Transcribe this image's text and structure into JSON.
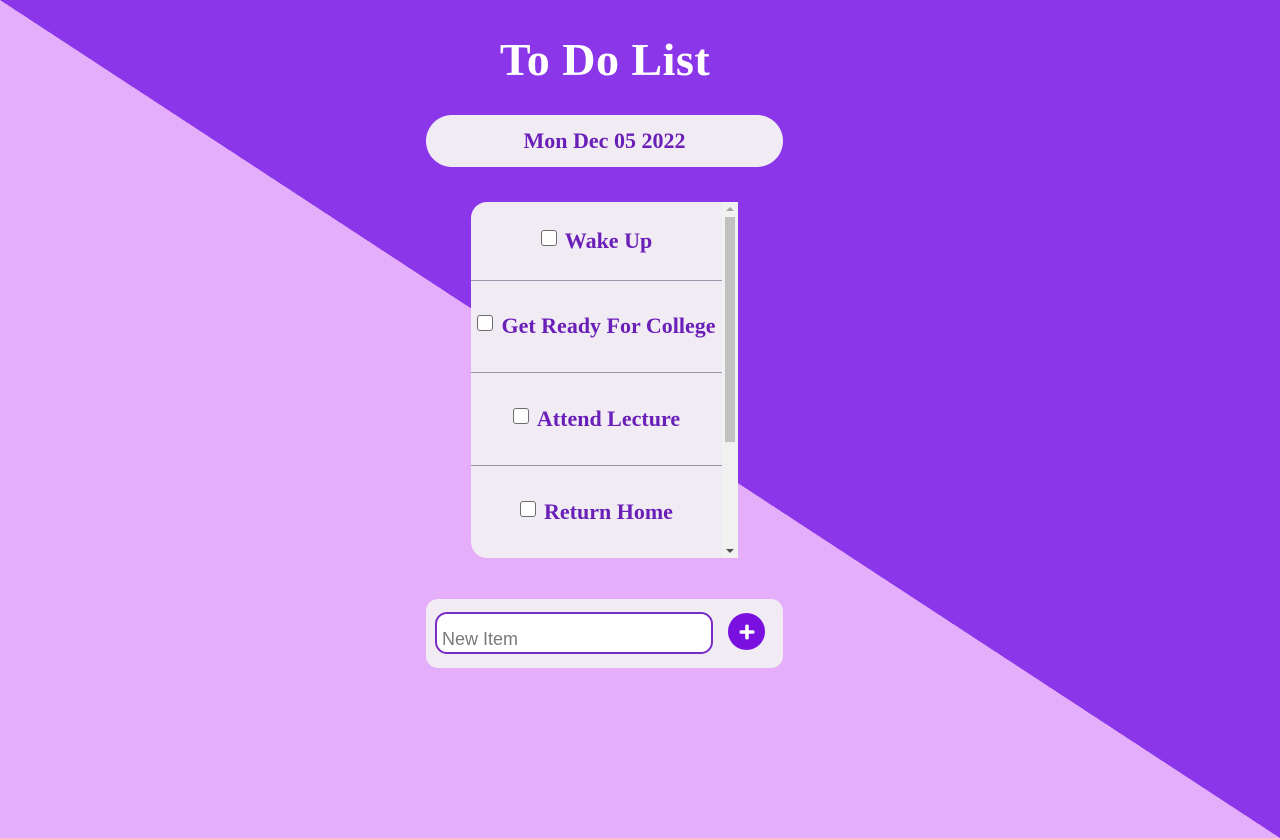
{
  "header": {
    "title": "To Do List"
  },
  "date": {
    "label": "Mon Dec 05 2022"
  },
  "todo_list": {
    "items": [
      {
        "label": "Wake Up",
        "checked": false
      },
      {
        "label": "Get Ready For College",
        "checked": false
      },
      {
        "label": "Attend Lecture",
        "checked": false
      },
      {
        "label": "Return Home",
        "checked": false
      }
    ]
  },
  "add_form": {
    "placeholder": "New Item",
    "value": "",
    "button_icon": "plus-icon"
  },
  "colors": {
    "background_dark": "#8B36E8",
    "background_light": "#E4AEFB",
    "panel": "#F1EBF4",
    "text_accent": "#6A1FB8",
    "button": "#7A10E0"
  }
}
